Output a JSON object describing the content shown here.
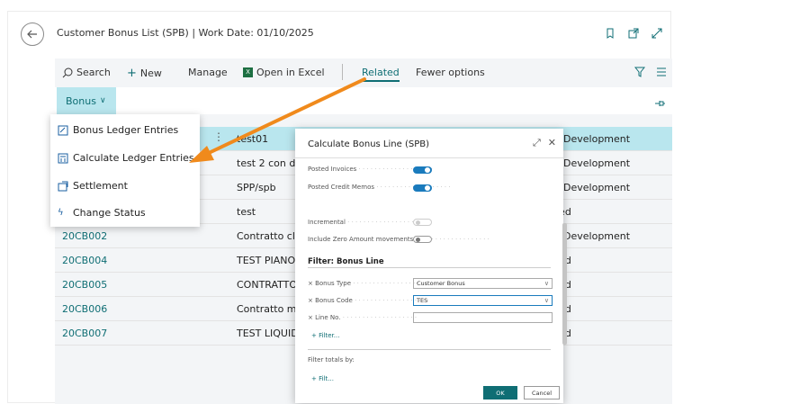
{
  "header": {
    "title": "Customer Bonus List (SPB) | Work Date: 01/10/2025"
  },
  "toolbar": {
    "search": "Search",
    "new": "New",
    "manage": "Manage",
    "open_excel": "Open in Excel",
    "related": "Related",
    "fewer_options": "Fewer options"
  },
  "bonus_tab": {
    "label": "Bonus"
  },
  "grid": {
    "rows": [
      {
        "no": "",
        "description": "test01",
        "status": "r Development",
        "selected": true
      },
      {
        "no": "",
        "description": "test 2 con do",
        "status": "r Development"
      },
      {
        "no": "",
        "description": "SPP/spb",
        "status": "r Development"
      },
      {
        "no": "",
        "description": "test",
        "status": "ied"
      },
      {
        "no": "20CB002",
        "description": "Contratto clie",
        "status": "r Development"
      },
      {
        "no": "20CB004",
        "description": "TEST PIANO L",
        "status": "ied"
      },
      {
        "no": "20CB005",
        "description": "CONTRATTO",
        "status": "ied"
      },
      {
        "no": "20CB006",
        "description": "Contratto mu",
        "status": "ied"
      },
      {
        "no": "20CB007",
        "description": "TEST LIQUIDA",
        "status": "ied"
      }
    ]
  },
  "menu": {
    "items": [
      {
        "label": "Bonus Ledger Entries",
        "icon": "ledger-icon"
      },
      {
        "label": "Calculate Ledger Entries",
        "icon": "calculate-icon"
      },
      {
        "label": "Settlement",
        "icon": "settlement-icon"
      },
      {
        "label": "Change Status",
        "icon": "lightning-icon"
      }
    ]
  },
  "dialog": {
    "title": "Calculate Bonus Line (SPB)",
    "posted_invoices": "Posted Invoices",
    "posted_credit_memos": "Posted Credit Memos",
    "incremental": "Incremental",
    "include_zero": "Include Zero Amount movements",
    "filter_section": "Filter: Bonus Line",
    "bonus_type_label": "× Bonus Type",
    "bonus_type_value": "Customer Bonus",
    "bonus_code_label": "× Bonus Code",
    "bonus_code_value": "TES",
    "line_no_label": "× Line No.",
    "filter_link": "+ Filter...",
    "filter_totals": "Filter totals by:",
    "filter_link2": "+ Filt...",
    "ok": "OK",
    "cancel": "Cancel"
  },
  "colors": {
    "accent": "#0f6e74",
    "selection": "#b9e6ee",
    "toggle_on": "#1a7bbd",
    "arrow": "#f08a1c"
  }
}
